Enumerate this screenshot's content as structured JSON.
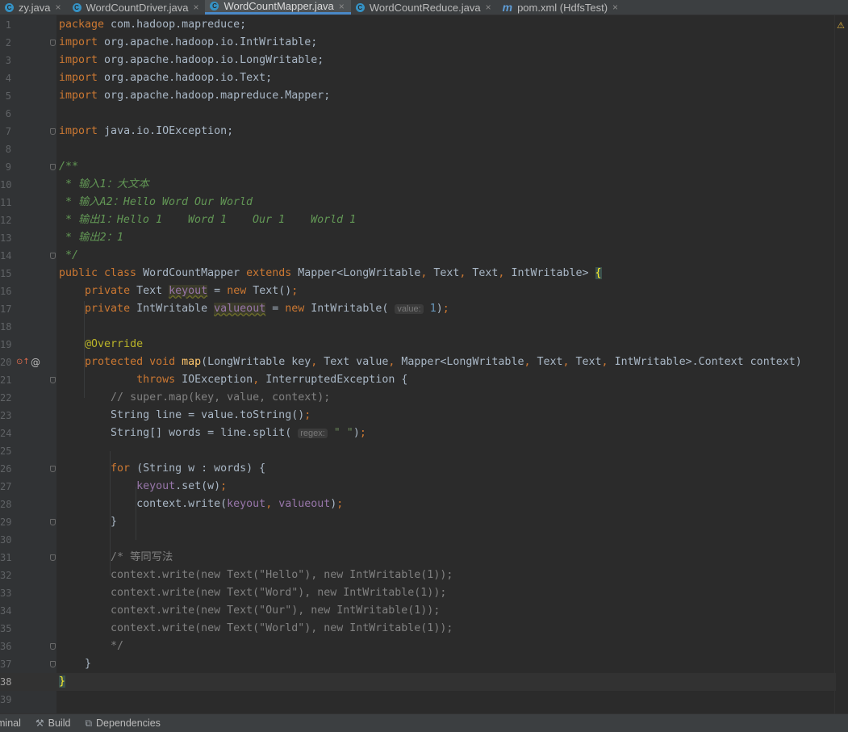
{
  "tabs": [
    {
      "label": "zy.java",
      "icon": "java-class-icon",
      "active": false
    },
    {
      "label": "WordCountDriver.java",
      "icon": "java-class-icon",
      "active": false
    },
    {
      "label": "WordCountMapper.java",
      "icon": "java-class-icon",
      "active": true
    },
    {
      "label": "WordCountReduce.java",
      "icon": "java-class-icon",
      "active": false
    },
    {
      "label": "pom.xml (HdfsTest)",
      "icon": "maven-icon",
      "active": false
    }
  ],
  "editor": {
    "current_line": 38,
    "warning_indicator": "⚠",
    "lines": [
      {
        "n": 1,
        "html": "<span class='kw'>package</span> com.hadoop.mapreduce;"
      },
      {
        "n": 2,
        "html": "<span class='kw'>import</span> org.apache.hadoop.io.IntWritable;",
        "fold": true
      },
      {
        "n": 3,
        "html": "<span class='kw'>import</span> org.apache.hadoop.io.LongWritable;"
      },
      {
        "n": 4,
        "html": "<span class='kw'>import</span> org.apache.hadoop.io.Text;"
      },
      {
        "n": 5,
        "html": "<span class='kw'>import</span> org.apache.hadoop.mapreduce.Mapper;"
      },
      {
        "n": 6,
        "html": ""
      },
      {
        "n": 7,
        "html": "<span class='kw'>import</span> java.io.IOException;",
        "fold": true
      },
      {
        "n": 8,
        "html": ""
      },
      {
        "n": 9,
        "html": "<span class='doc'>/**</span>",
        "fold": true
      },
      {
        "n": 10,
        "html": "<span class='doc'> * 输入1：大文本</span>"
      },
      {
        "n": 11,
        "html": "<span class='doc'> * 输入A2：Hello Word Our World</span>"
      },
      {
        "n": 12,
        "html": "<span class='doc'> * 输出1：Hello 1    Word 1    Our 1    World 1</span>"
      },
      {
        "n": 13,
        "html": "<span class='doc'> * 输出2：1</span>"
      },
      {
        "n": 14,
        "html": "<span class='doc'> */</span>",
        "fold": true
      },
      {
        "n": 15,
        "html": "<span class='kw'>public class</span> WordCountMapper <span class='kw'>extends</span> Mapper&lt;LongWritable<span class='kw'>,</span> Text<span class='kw'>,</span> Text<span class='kw'>,</span> IntWritable&gt; <span class='brace-hl'>{</span>"
      },
      {
        "n": 16,
        "html": "    <span class='kw'>private</span> Text <span class='fld warn-u'>keyout</span> = <span class='kw'>new</span> Text()<span class='kw'>;</span>"
      },
      {
        "n": 17,
        "html": "    <span class='kw'>private</span> IntWritable <span class='fld warn-u'>valueout</span> = <span class='kw'>new</span> IntWritable( <span class='hint'>value:</span> <span class='num'>1</span>)<span class='kw'>;</span>"
      },
      {
        "n": 18,
        "html": ""
      },
      {
        "n": 19,
        "html": "    <span class='ann'>@Override</span>"
      },
      {
        "n": 20,
        "html": "    <span class='kw'>protected void</span> <span class='fn'>map</span>(LongWritable key<span class='kw'>,</span> Text value<span class='kw'>,</span> Mapper&lt;LongWritable<span class='kw'>,</span> Text<span class='kw'>,</span> Text<span class='kw'>,</span> IntWritable&gt;.Context context)",
        "gutter_icons": true
      },
      {
        "n": 21,
        "html": "            <span class='kw'>throws</span> IOException<span class='kw'>,</span> InterruptedException {",
        "fold": true
      },
      {
        "n": 22,
        "html": "        <span class='cm'>// super.map(key, value, context);</span>"
      },
      {
        "n": 23,
        "html": "        String line = value.toString()<span class='kw'>;</span>"
      },
      {
        "n": 24,
        "html": "        String[] words = line.split( <span class='hint'>regex:</span> <span class='str'>\" \"</span>)<span class='kw'>;</span>"
      },
      {
        "n": 25,
        "html": ""
      },
      {
        "n": 26,
        "html": "        <span class='kw'>for</span> (String w : words) {",
        "fold": true
      },
      {
        "n": 27,
        "html": "            <span class='fld'>keyout</span>.set(w)<span class='kw'>;</span>"
      },
      {
        "n": 28,
        "html": "            context.write(<span class='fld'>keyout</span><span class='kw'>,</span> <span class='fld'>valueout</span>)<span class='kw'>;</span>"
      },
      {
        "n": 29,
        "html": "        }",
        "fold": true
      },
      {
        "n": 30,
        "html": ""
      },
      {
        "n": 31,
        "html": "        <span class='cm'>/* 等同写法</span>",
        "fold": true
      },
      {
        "n": 32,
        "html": "<span class='cm'>        context.write(new Text(\"Hello\"), new IntWritable(1));</span>"
      },
      {
        "n": 33,
        "html": "<span class='cm'>        context.write(new Text(\"Word\"), new IntWritable(1));</span>"
      },
      {
        "n": 34,
        "html": "<span class='cm'>        context.write(new Text(\"Our\"), new IntWritable(1));</span>"
      },
      {
        "n": 35,
        "html": "<span class='cm'>        context.write(new Text(\"World\"), new IntWritable(1));</span>"
      },
      {
        "n": 36,
        "html": "<span class='cm'>        */</span>",
        "fold": true
      },
      {
        "n": 37,
        "html": "    }",
        "fold": true
      },
      {
        "n": 38,
        "html": "<span class='brace-hl'>}</span>"
      },
      {
        "n": 39,
        "html": ""
      }
    ]
  },
  "statusbar": {
    "items": [
      {
        "label": "minal",
        "icon": ""
      },
      {
        "label": "Build",
        "icon": "hammer-icon"
      },
      {
        "label": "Dependencies",
        "icon": "dependencies-icon"
      }
    ]
  }
}
